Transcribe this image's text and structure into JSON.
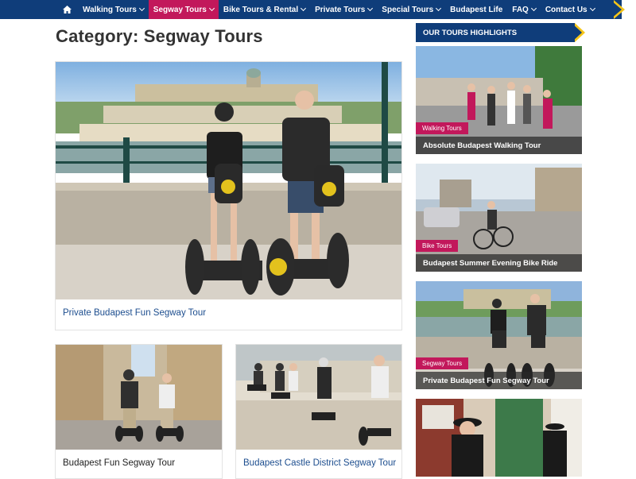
{
  "nav": {
    "items": [
      {
        "label": "Walking Tours",
        "dropdown": true,
        "active": false
      },
      {
        "label": "Segway Tours",
        "dropdown": true,
        "active": true
      },
      {
        "label": "Bike Tours & Rental",
        "dropdown": true,
        "active": false
      },
      {
        "label": "Private Tours",
        "dropdown": true,
        "active": false
      },
      {
        "label": "Special Tours",
        "dropdown": true,
        "active": false
      },
      {
        "label": "Budapest Life",
        "dropdown": false,
        "active": false
      },
      {
        "label": "FAQ",
        "dropdown": true,
        "active": false
      },
      {
        "label": "Contact Us",
        "dropdown": true,
        "active": false
      }
    ],
    "home_icon": "home-icon"
  },
  "page": {
    "title": "Category: Segway Tours"
  },
  "posts": [
    {
      "title": "Private Budapest Fun Segway Tour",
      "title_color": "#1d4e8f"
    },
    {
      "title": "Budapest Fun Segway Tour",
      "title_color": "#222222"
    },
    {
      "title": "Budapest Castle District Segway Tour",
      "title_color": "#1d4e8f"
    }
  ],
  "sidebar": {
    "header": "OUR TOURS HIGHLIGHTS",
    "items": [
      {
        "badge": "Walking Tours",
        "caption": "Absolute Budapest Walking Tour"
      },
      {
        "badge": "Bike Tours",
        "caption": "Budapest Summer Evening Bike Ride"
      },
      {
        "badge": "Segway Tours",
        "caption": "Private Budapest Fun Segway Tour"
      }
    ]
  },
  "colors": {
    "nav_bg": "#0f3d7a",
    "accent": "#c2185b",
    "arrow": "#f5c518",
    "link": "#1d4e8f"
  }
}
